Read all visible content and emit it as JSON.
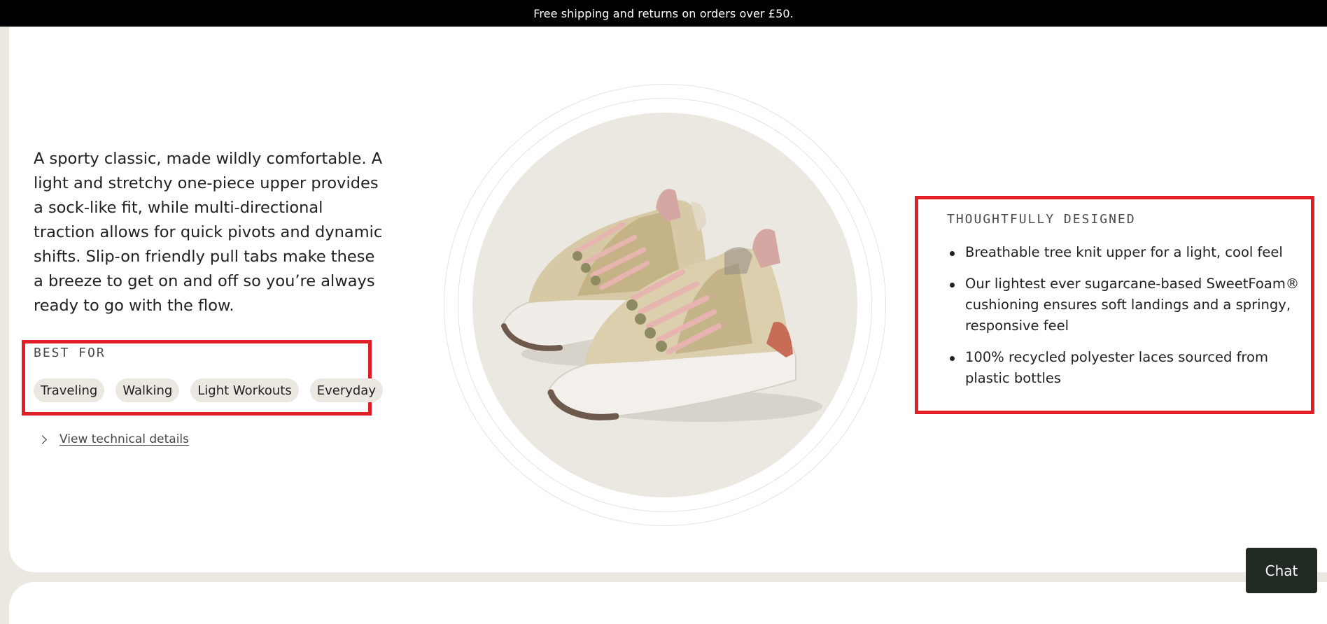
{
  "announcement": {
    "text": "Free shipping and returns on orders over £50."
  },
  "product": {
    "description": "A sporty classic, made wildly comfortable. A light and stretchy one-piece upper provides a sock-like fit, while multi-directional traction allows for quick pivots and dynamic shifts. Slip-on friendly pull tabs make these a breeze to get on and off so you’re always ready to go with the flow.",
    "best_for": {
      "heading": "BEST FOR",
      "tags": [
        "Traveling",
        "Walking",
        "Light Workouts",
        "Everyday"
      ]
    },
    "technical_details_link": "View technical details",
    "image": {
      "alt_icon": "sneaker-image",
      "colors": {
        "knit": "#d8c9a6",
        "laces": "#e6b5b0",
        "sole": "#f0ede8",
        "heel_accent": "#c86c55",
        "background_disc": "#ebe8e2"
      }
    }
  },
  "thoughtfully_designed": {
    "heading": "THOUGHTFULLY DESIGNED",
    "features": [
      "Breathable tree knit upper for a light, cool feel",
      "Our lightest ever sugarcane-based SweetFoam® cushioning ensures soft landings and a springy, responsive feel",
      "100% recycled polyester laces sourced from plastic bottles"
    ]
  },
  "chat": {
    "label": "Chat"
  },
  "colors": {
    "highlight_border": "#e01e25",
    "page_background": "#ebe8e2",
    "chat_background": "#212a22"
  }
}
